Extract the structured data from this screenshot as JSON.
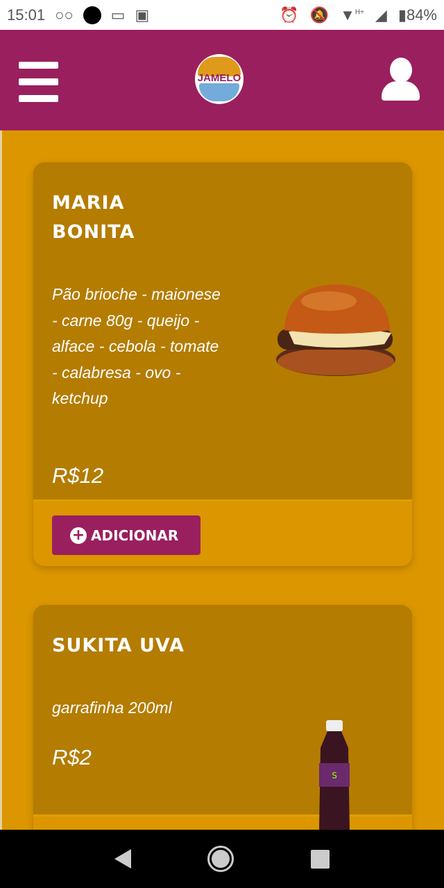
{
  "status_bar": {
    "time": "15:01",
    "battery": "84%",
    "network": "H+"
  },
  "header": {
    "logo_text": "JAMELO",
    "menu_icon": "hamburger-icon",
    "user_icon": "user-icon",
    "color": "#9a1f5e"
  },
  "products": [
    {
      "name_line1": "MARIA",
      "name_line2": "BONITA",
      "description": "Pão brioche - maionese - carne 80g - queijo - alface - cebola - tomate - calabresa - ovo - ketchup",
      "price": "R$12",
      "button": "ADICIONAR"
    },
    {
      "name": "SUKITA UVA",
      "description": "garrafinha 200ml",
      "price": "R$2"
    }
  ],
  "colors": {
    "background": "#db9600",
    "card": "#b47c00",
    "accent": "#9a1f5e"
  }
}
